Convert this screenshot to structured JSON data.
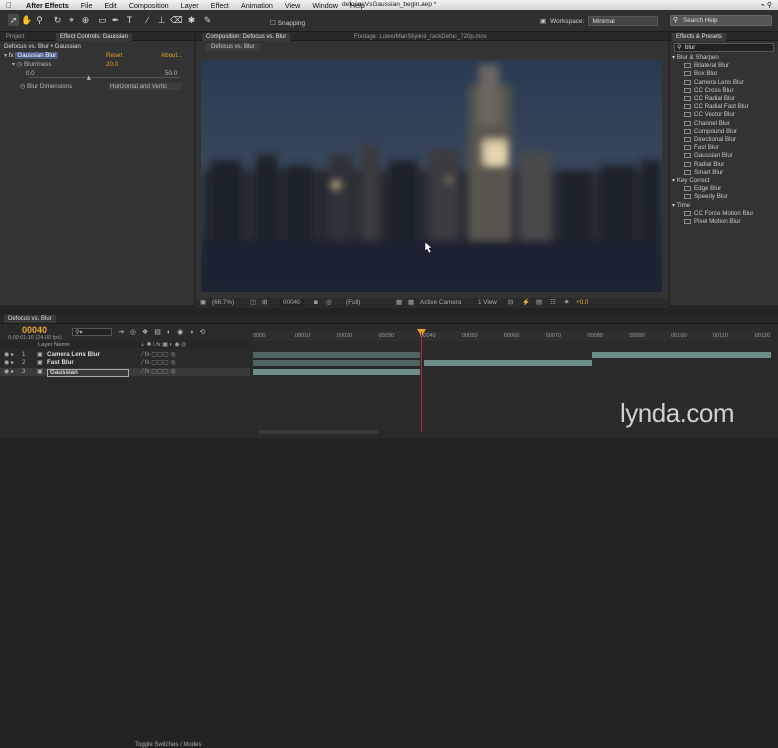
{
  "menubar": {
    "app": "After Effects",
    "items": [
      "File",
      "Edit",
      "Composition",
      "Layer",
      "Effect",
      "Animation",
      "View",
      "Window",
      "Help"
    ],
    "doc_title": "defocusVsGaussian_begin.aep *"
  },
  "toolbar": {
    "snapping_label": "Snapping",
    "workspace_label": "Workspace:",
    "workspace_value": "Minimal",
    "search_help_placeholder": "Search Help"
  },
  "effect_controls": {
    "tab_project": "Project",
    "tab_label": "Effect Controls: Gaussian",
    "header": "Defocus vs. Blur • Gaussian",
    "effect_name": "Gaussian Blur",
    "reset_label": "Reset",
    "about_label": "About...",
    "blurriness_label": "Blurriness",
    "blurriness_value": "20.0",
    "slider_min": "0.0",
    "slider_max": "50.0",
    "slider_fraction": 0.4,
    "dimensions_label": "Blur Dimensions",
    "dimensions_value": "Horizontal and Vertic"
  },
  "composition": {
    "tab_label": "Composition: Defocus vs. Blur",
    "footage_tab": "Footage: LowerManSkyline_rackDefoc_720p.mov",
    "subtab": "Defocus vs. Blur",
    "zoom": "(66.7%)",
    "timecode": "00040",
    "resolution": "(Full)",
    "camera": "Active Camera",
    "view": "1 View",
    "exposure": "+0.0"
  },
  "effects_presets": {
    "tab_label": "Effects & Presets",
    "search_value": "blur",
    "groups": [
      {
        "name": "Blur & Sharpen",
        "items": [
          "Bilateral Blur",
          "Box Blur",
          "Camera Lens Blur",
          "CC Cross Blur",
          "CC Radial Blur",
          "CC Radial Fast Blur",
          "CC Vector Blur",
          "Channel Blur",
          "Compound Blur",
          "Directional Blur",
          "Fast Blur",
          "Gaussian Blur",
          "Radial Blur",
          "Smart Blur"
        ]
      },
      {
        "name": "Key Correct",
        "items": [
          "Edge Blur",
          "Speedy Blur"
        ]
      },
      {
        "name": "Time",
        "items": [
          "CC Force Motion Blur",
          "Pixel Motion Blur"
        ]
      }
    ]
  },
  "timeline": {
    "tab_label": "Defocus vs. Blur",
    "timecode": "00040",
    "timecode_sub": "0:00:01:16 (24.00 fps)",
    "layer_name_header": "Layer Name",
    "layers": [
      {
        "num": "1",
        "name": "Camera Lens Blur"
      },
      {
        "num": "2",
        "name": "Fast Blur"
      },
      {
        "num": "3",
        "name": "Gaussian"
      }
    ],
    "ruler": [
      "0000",
      "00010",
      "00020",
      "00030",
      "00040",
      "00050",
      "00060",
      "00070",
      "00080",
      "00090",
      "00100",
      "00110",
      "00120"
    ],
    "toggle_label": "Toggle Switches / Modes"
  },
  "watermark": "lynda.com",
  "colors": {
    "accent": "#e8a52c",
    "playhead": "#c0272d",
    "selected_tab": "#4a5a88",
    "track_bar": "#6f8e8b"
  }
}
